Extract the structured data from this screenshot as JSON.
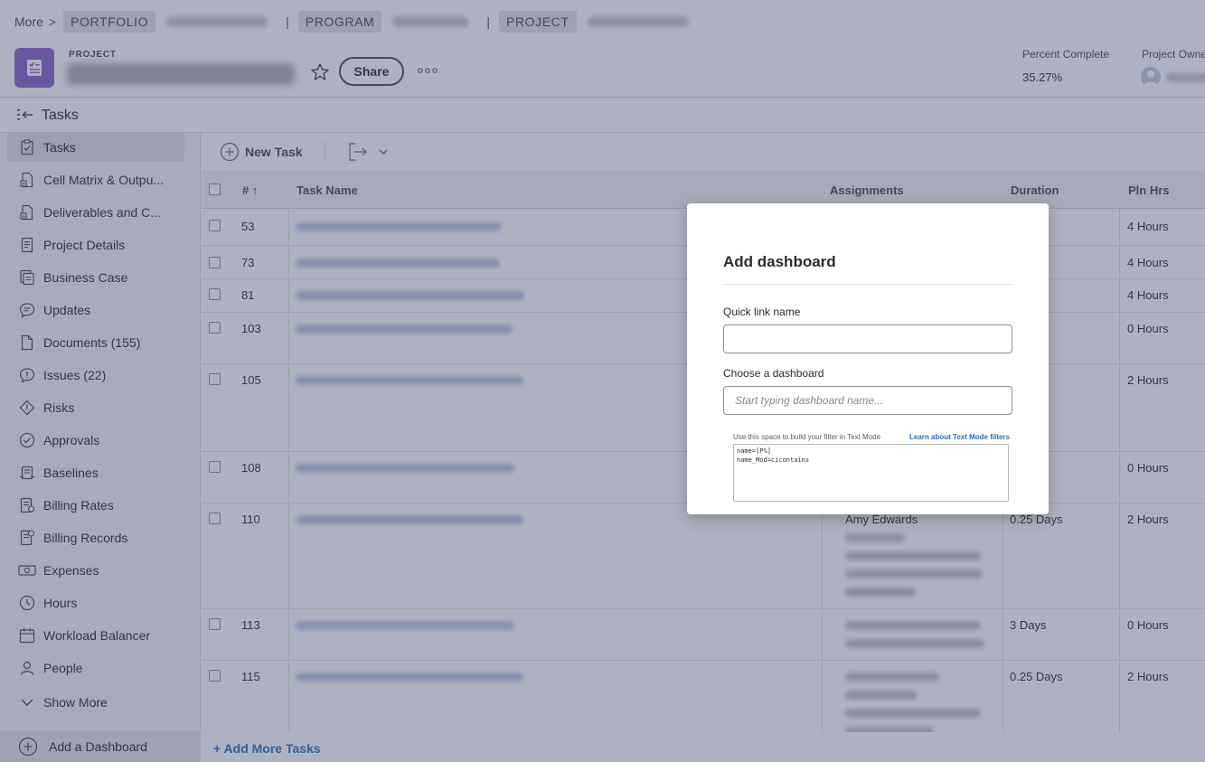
{
  "breadcrumb": {
    "more_label": "More",
    "portfolio_label": "PORTFOLIO",
    "program_label": "PROGRAM",
    "project_label": "PROJECT",
    "separator": "|"
  },
  "project": {
    "type_label": "PROJECT",
    "share_label": "Share",
    "percent_complete_label": "Percent Complete",
    "percent_complete_value": "35.27%",
    "percent_complete_fraction": 0.3527,
    "owner_label": "Project Owner"
  },
  "tasks_bar": {
    "title": "Tasks"
  },
  "sidebar": {
    "items": [
      {
        "label": "Tasks",
        "icon": "clipboard-check-icon",
        "active": true
      },
      {
        "label": "Cell Matrix & Outpu...",
        "icon": "document-chart-icon"
      },
      {
        "label": "Deliverables and C...",
        "icon": "document-chart-icon"
      },
      {
        "label": "Project Details",
        "icon": "document-icon"
      },
      {
        "label": "Business Case",
        "icon": "document-list-icon"
      },
      {
        "label": "Updates",
        "icon": "speech-bubble-icon"
      },
      {
        "label": "Documents (155)",
        "icon": "document-icon"
      },
      {
        "label": "Issues (22)",
        "icon": "issue-bubble-icon"
      },
      {
        "label": "Risks",
        "icon": "warning-diamond-icon"
      },
      {
        "label": "Approvals",
        "icon": "check-circle-icon"
      },
      {
        "label": "Baselines",
        "icon": "baseline-icon"
      },
      {
        "label": "Billing Rates",
        "icon": "billing-doc-icon"
      },
      {
        "label": "Billing Records",
        "icon": "billing-doc-icon"
      },
      {
        "label": "Expenses",
        "icon": "money-icon"
      },
      {
        "label": "Hours",
        "icon": "clock-icon"
      },
      {
        "label": "Workload Balancer",
        "icon": "calendar-icon"
      },
      {
        "label": "People",
        "icon": "person-icon"
      },
      {
        "label": "Show More",
        "icon": "chevron-down-icon"
      }
    ],
    "add_dashboard_label": "Add a Dashboard"
  },
  "toolbar": {
    "new_task_label": "New Task"
  },
  "table": {
    "columns": {
      "num": "#",
      "task_name": "Task Name",
      "assignments": "Assignments",
      "duration": "Duration",
      "pln_hrs": "Pln Hrs"
    },
    "rows": [
      {
        "num": "53",
        "duration": "",
        "pln_hrs": "4 Hours"
      },
      {
        "num": "73",
        "duration": "",
        "pln_hrs": "4 Hours"
      },
      {
        "num": "81",
        "duration": "",
        "pln_hrs": "4 Hours"
      },
      {
        "num": "103",
        "duration": "",
        "pln_hrs": "0 Hours"
      },
      {
        "num": "105",
        "duration": "",
        "pln_hrs": "2 Hours"
      },
      {
        "num": "108",
        "duration": "",
        "pln_hrs": "0 Hours"
      },
      {
        "num": "110",
        "duration": "0.25 Days",
        "pln_hrs": "2 Hours",
        "assignee": "Amy Edwards"
      },
      {
        "num": "113",
        "duration": "3 Days",
        "pln_hrs": "0 Hours"
      },
      {
        "num": "115",
        "duration": "0.25 Days",
        "pln_hrs": "2 Hours"
      }
    ],
    "add_more_label": "+ Add More Tasks"
  },
  "modal": {
    "title": "Add dashboard",
    "quick_link_label": "Quick link name",
    "quick_link_value": "",
    "dashboard_label": "Choose a dashboard",
    "dashboard_placeholder": "Start typing dashboard name...",
    "filter_hint": "Use this space to build your filter in Text Mode",
    "filter_link": "Learn about Text Mode filters",
    "filter_text": "name=[P%]\nname_Mod=cicontains"
  },
  "colors": {
    "accent": "#8b5fc6",
    "link": "#2d6db5",
    "overlay": "#3e4868"
  }
}
